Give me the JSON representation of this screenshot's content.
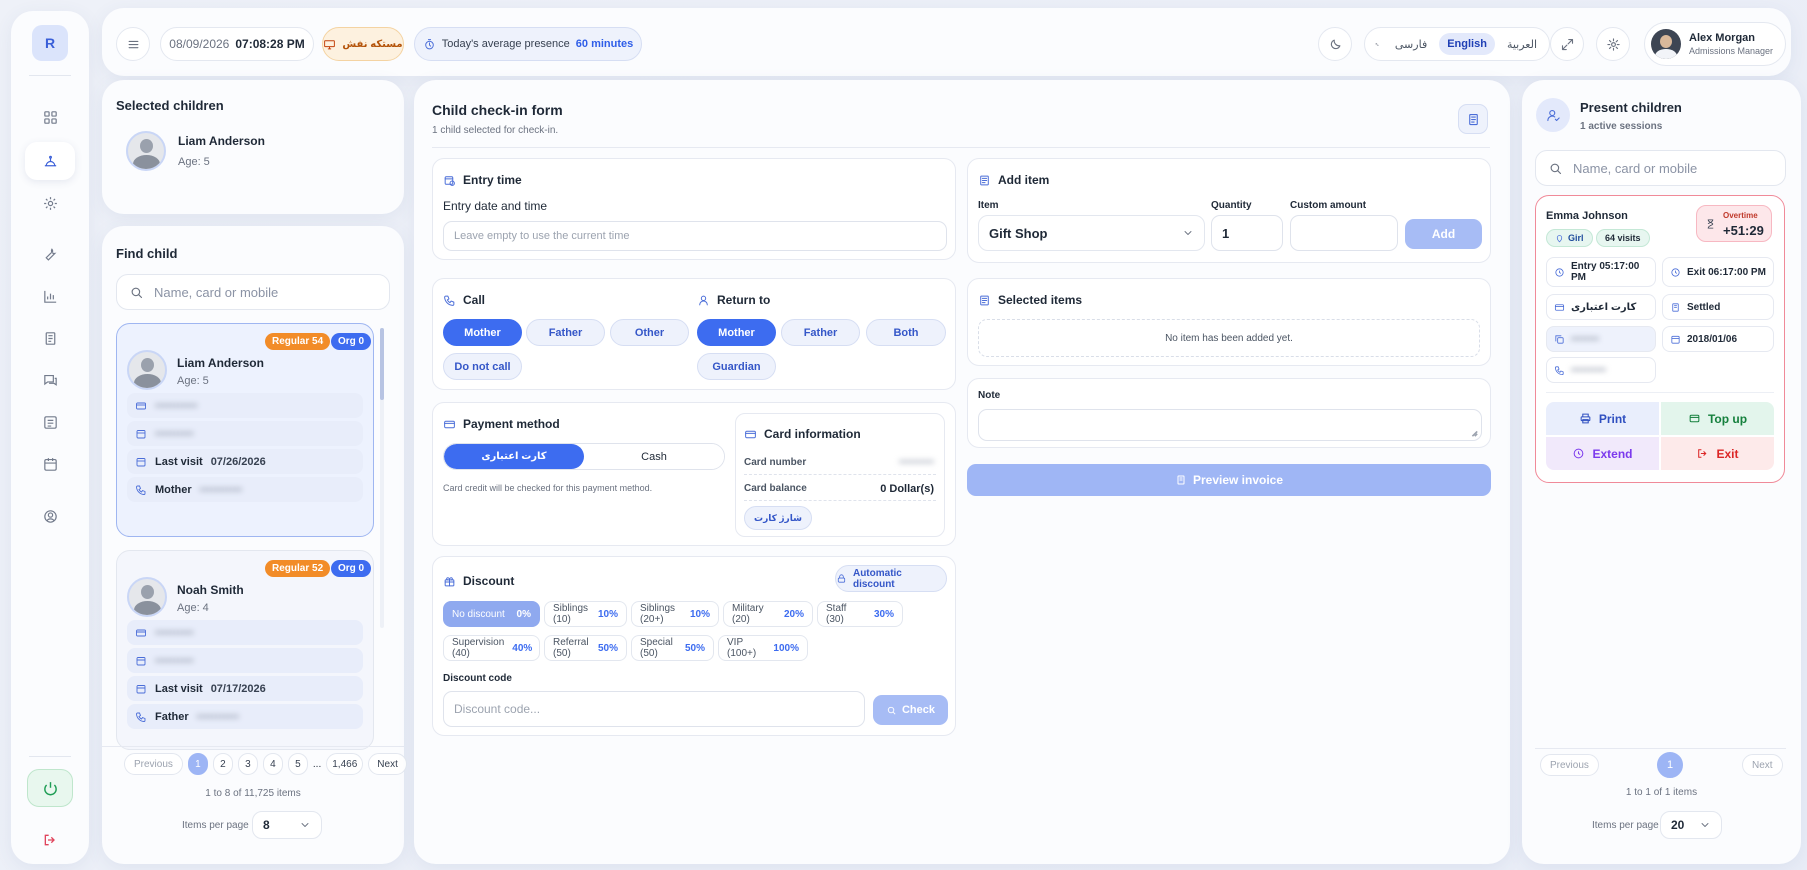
{
  "sidebar": {
    "logo": "R",
    "items": [
      "dashboard-icon",
      "check-in-icon",
      "settings-icon",
      "tools-icon",
      "reports-icon",
      "receipt-icon",
      "messages-icon",
      "notes-icon",
      "calendar-icon",
      "profile-icon"
    ]
  },
  "header": {
    "date": "08/09/2026",
    "time": "07:08:28 PM",
    "device_label": "مستكه نفش",
    "presence_label": "Today's average presence",
    "presence_value": "60 minutes",
    "languages": [
      "فارسی",
      "English",
      "العربية"
    ],
    "active_language": "English",
    "user_name": "Alex Morgan",
    "user_role": "Admissions Manager"
  },
  "selected_children": {
    "title": "Selected children",
    "child": {
      "name": "Liam Anderson",
      "age": "Age: 5"
    }
  },
  "find_child": {
    "title": "Find child",
    "search_placeholder": "Name, card or mobile",
    "results": [
      {
        "name": "Liam Anderson",
        "age": "Age: 5",
        "badge_regular": "Regular 54",
        "badge_org": "Org 0",
        "card_masked": "•••••••••••",
        "date_masked": "••••••••••",
        "last_visit_label": "Last visit",
        "last_visit": "07/26/2026",
        "contact_label": "Mother",
        "contact_masked": "•••••••••••"
      },
      {
        "name": "Noah Smith",
        "age": "Age: 4",
        "badge_regular": "Regular 52",
        "badge_org": "Org 0",
        "card_masked": "••••••••••",
        "date_masked": "••••••••••",
        "last_visit_label": "Last visit",
        "last_visit": "07/17/2026",
        "contact_label": "Father",
        "contact_masked": "•••••••••••"
      }
    ],
    "pagination": {
      "previous": "Previous",
      "pages": [
        "1",
        "2",
        "3",
        "4",
        "5",
        "...",
        "1,466"
      ],
      "next": "Next",
      "summary": "1 to 8 of 11,725 items"
    },
    "items_per_page_label": "Items per page",
    "items_per_page": "8"
  },
  "form": {
    "title": "Child check-in form",
    "subtitle": "1 child selected for check-in.",
    "entry_time": {
      "title": "Entry time",
      "label": "Entry date and time",
      "placeholder": "Leave empty to use the current time"
    },
    "call": {
      "title": "Call",
      "options": [
        "Mother",
        "Father",
        "Other",
        "Do not call"
      ],
      "selected": "Mother"
    },
    "return_to": {
      "title": "Return to",
      "options": [
        "Mother",
        "Father",
        "Both",
        "Guardian"
      ],
      "selected": "Mother"
    },
    "payment": {
      "title": "Payment method",
      "options": [
        "كارت اعتباری",
        "Cash"
      ],
      "selected": "كارت اعتباری",
      "note": "Card credit will be checked for this payment method."
    },
    "card_info": {
      "title": "Card information",
      "number_label": "Card number",
      "number_masked": "••••••••••",
      "balance_label": "Card balance",
      "balance_value": "0 Dollar(s)",
      "charge_button": "شارژ کارت"
    },
    "discount": {
      "title": "Discount",
      "auto_button": "Automatic discount",
      "options": [
        {
          "label": "No discount",
          "pct": "0%"
        },
        {
          "label": "Siblings (10)",
          "pct": "10%"
        },
        {
          "label": "Siblings (20+)",
          "pct": "10%"
        },
        {
          "label": "Military (20)",
          "pct": "20%"
        },
        {
          "label": "Staff (30)",
          "pct": "30%"
        },
        {
          "label": "Supervision (40)",
          "pct": "40%"
        },
        {
          "label": "Referral (50)",
          "pct": "50%"
        },
        {
          "label": "Special (50)",
          "pct": "50%"
        },
        {
          "label": "VIP (100+)",
          "pct": "100%"
        }
      ],
      "code_label": "Discount code",
      "code_placeholder": "Discount code...",
      "check_button": "Check"
    },
    "add_item": {
      "title": "Add item",
      "item_label": "Item",
      "item_value": "Gift Shop",
      "quantity_label": "Quantity",
      "quantity_value": "1",
      "custom_label": "Custom amount",
      "add_button": "Add"
    },
    "selected_items": {
      "title": "Selected items",
      "empty": "No item has been added yet."
    },
    "note": {
      "title": "Note"
    },
    "preview_button": "Preview invoice"
  },
  "present_children": {
    "title": "Present children",
    "subtitle": "1 active sessions",
    "search_placeholder": "Name, card or mobile",
    "session": {
      "name": "Emma Johnson",
      "overtime_label": "Overtime",
      "overtime_value": "+51:29",
      "gender": "Girl",
      "visits": "64 visits",
      "entry": "Entry 05:17:00 PM",
      "exit": "Exit 06:17:00 PM",
      "payment": "کارت اعتباری",
      "status": "Settled",
      "card_masked": "••••••••",
      "date": "2018/01/06",
      "phone_masked": "••••••••••",
      "actions": {
        "print": "Print",
        "topup": "Top up",
        "extend": "Extend",
        "exit": "Exit"
      }
    },
    "pagination": {
      "previous": "Previous",
      "page": "1",
      "next": "Next",
      "summary": "1 to 1 of 1 items"
    },
    "items_per_page_label": "Items per page",
    "items_per_page": "20"
  },
  "colors": {
    "accent": "#3d6cf0",
    "orange": "#f28c28",
    "danger": "#e0445c",
    "success": "#1f9d55"
  }
}
